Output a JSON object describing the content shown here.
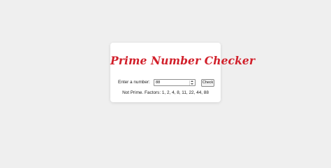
{
  "page": {
    "background_color": "#efefef"
  },
  "card": {
    "title": "Prime Number Checker",
    "title_color": "#d11f2a",
    "input_label": "Enter a number:",
    "input_value": "88",
    "check_button_label": "Check",
    "result_text": "Not Prime. Factors: 1, 2, 4, 8, 11, 22, 44, 88"
  }
}
